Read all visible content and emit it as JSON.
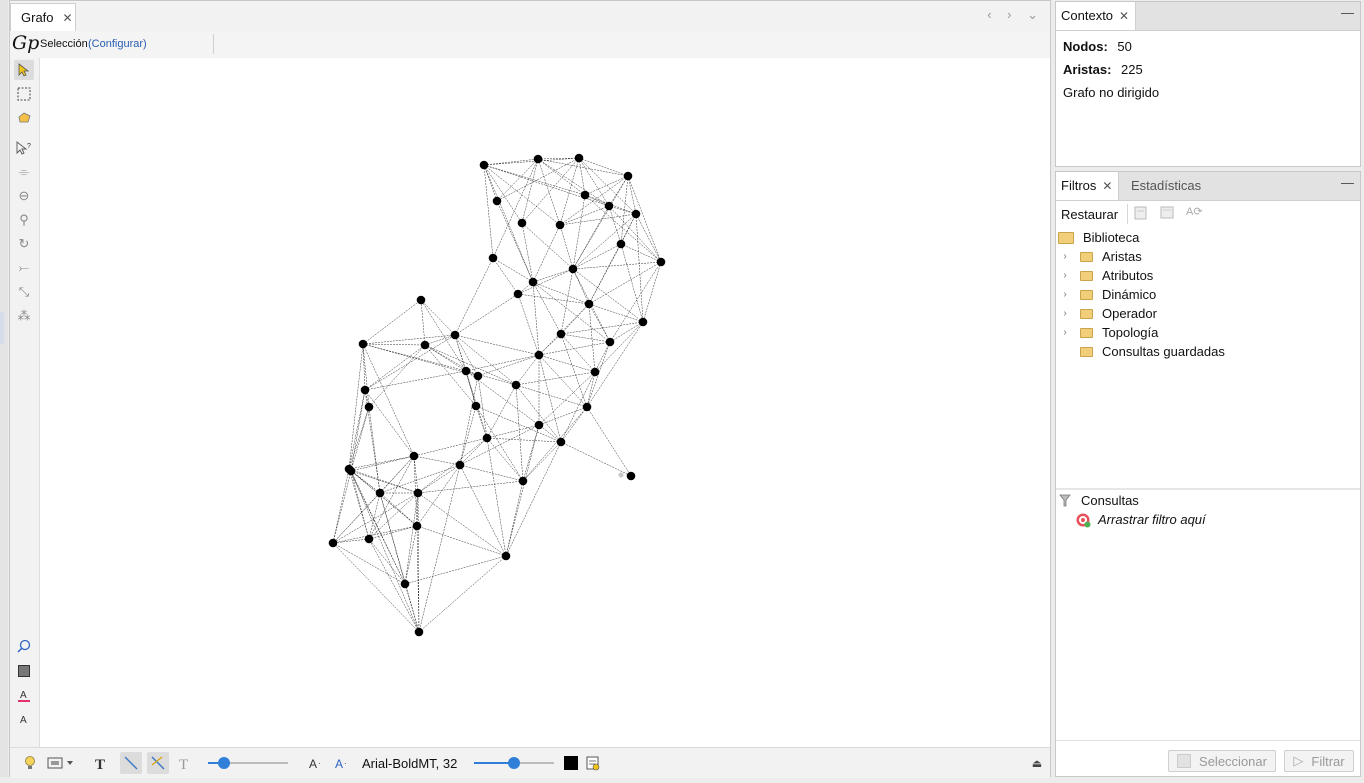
{
  "graph_window": {
    "tab_label": "Grafo",
    "close_glyph": "✕",
    "nav_glyphs": "‹ › ⌄",
    "selection_label": "Selección",
    "configure_link": "(Configurar)",
    "logo_text": "Gp"
  },
  "bottom_toolbar": {
    "font_label": "Arial-BoldMT, 32",
    "size_slider_value": 0.2,
    "font_slider_value": 0.5,
    "color_swatch": "#000000"
  },
  "context_panel": {
    "tab_label": "Contexto",
    "nodes_label": "Nodos:",
    "nodes_value": "50",
    "edges_label": "Aristas:",
    "edges_value": "225",
    "graph_type": "Grafo no dirigido"
  },
  "filters_panel": {
    "tab_filters": "Filtros",
    "tab_statistics": "Estadísticas",
    "reset_button": "Restaurar",
    "library_label": "Biblioteca",
    "tree_items": [
      "Aristas",
      "Atributos",
      "Dinámico",
      "Operador",
      "Topología",
      "Consultas guardadas"
    ],
    "queries_label": "Consultas",
    "drag_hint": "Arrastrar filtro aquí",
    "select_button": "Seleccionar",
    "filter_button": "Filtrar"
  },
  "graph": {
    "node_count": 50,
    "edge_count": 225,
    "node_color": "#000000",
    "edge_color": "#333333"
  },
  "colors": {
    "accent": "#2f7fd8",
    "link": "#2a5db0"
  }
}
